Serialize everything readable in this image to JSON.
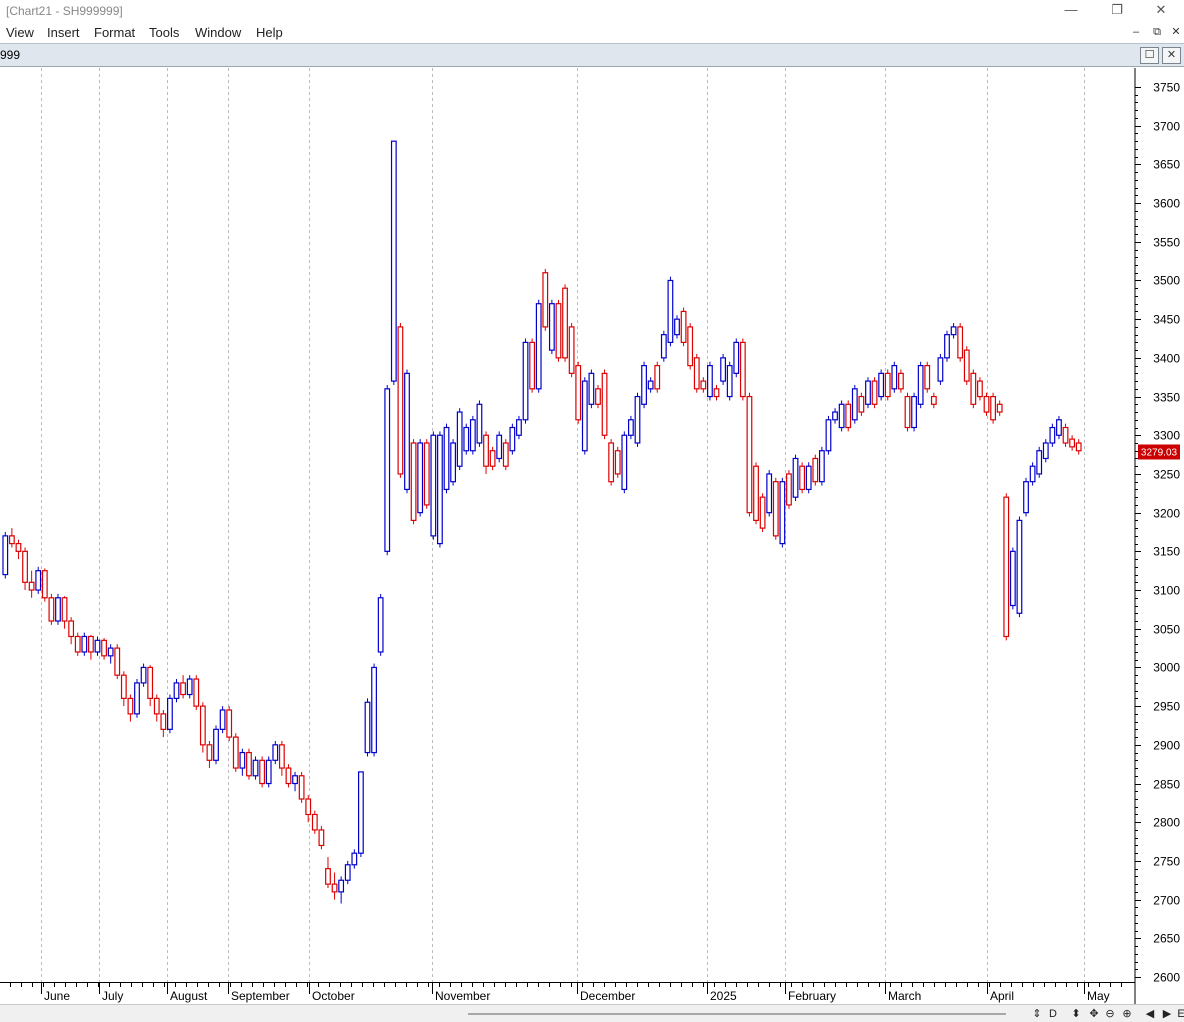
{
  "window": {
    "title": "[Chart21 - SH999999]",
    "controls": {
      "minimize": "—",
      "restore": "❐",
      "close": "✕"
    }
  },
  "menu": [
    "View",
    "Insert",
    "Format",
    "Tools",
    "Window",
    "Help"
  ],
  "child_window": {
    "title": "999",
    "controls": {
      "minimize": "–",
      "restore": "⧉",
      "close": "✕",
      "maximize": "☐",
      "close2": "✕"
    }
  },
  "bottom_nav": {
    "buttons": [
      "⇕",
      "D",
      "⬍",
      "✥",
      "⊖",
      "⊕",
      "◀",
      "▶",
      "E"
    ]
  },
  "colors": {
    "up": "#0000cc",
    "down": "#dd0000",
    "grid": "#bbbbbb",
    "badge_bg": "#cc0000"
  },
  "chart_data": {
    "type": "candlestick",
    "y_axis": {
      "ticks": [
        2600,
        2650,
        2700,
        2750,
        2800,
        2850,
        2900,
        2950,
        3000,
        3050,
        3100,
        3150,
        3200,
        3250,
        3300,
        3350,
        3400,
        3450,
        3500,
        3550,
        3600,
        3650,
        3700,
        3750
      ],
      "min": 2590,
      "max": 3770,
      "scale": "linear"
    },
    "x_axis": {
      "months": [
        "June",
        "July",
        "August",
        "September",
        "October",
        "November",
        "December",
        "2025",
        "February",
        "March",
        "April",
        "May"
      ]
    },
    "last_price": "3279.03",
    "grid": "vertical dashed at month boundaries",
    "candles": [
      [
        3120,
        3170,
        3115,
        3175
      ],
      [
        3170,
        3160,
        3155,
        3180
      ],
      [
        3160,
        3150,
        3140,
        3165
      ],
      [
        3150,
        3110,
        3100,
        3155
      ],
      [
        3110,
        3100,
        3090,
        3125
      ],
      [
        3100,
        3125,
        3095,
        3130
      ],
      [
        3125,
        3090,
        3085,
        3128
      ],
      [
        3090,
        3060,
        3055,
        3095
      ],
      [
        3060,
        3090,
        3055,
        3095
      ],
      [
        3090,
        3060,
        3050,
        3092
      ],
      [
        3060,
        3040,
        3030,
        3065
      ],
      [
        3040,
        3020,
        3015,
        3045
      ],
      [
        3020,
        3040,
        3015,
        3045
      ],
      [
        3040,
        3020,
        3010,
        3042
      ],
      [
        3020,
        3035,
        3015,
        3040
      ],
      [
        3035,
        3015,
        3010,
        3038
      ],
      [
        3015,
        3025,
        3005,
        3030
      ],
      [
        3025,
        2990,
        2985,
        3030
      ],
      [
        2990,
        2960,
        2950,
        2995
      ],
      [
        2960,
        2940,
        2930,
        2965
      ],
      [
        2940,
        2980,
        2935,
        2985
      ],
      [
        2980,
        3000,
        2975,
        3005
      ],
      [
        3000,
        2960,
        2950,
        3003
      ],
      [
        2960,
        2940,
        2930,
        2965
      ],
      [
        2940,
        2920,
        2910,
        2945
      ],
      [
        2920,
        2960,
        2915,
        2965
      ],
      [
        2960,
        2980,
        2955,
        2985
      ],
      [
        2980,
        2965,
        2960,
        2990
      ],
      [
        2965,
        2985,
        2960,
        2990
      ],
      [
        2985,
        2950,
        2945,
        2990
      ],
      [
        2950,
        2900,
        2890,
        2955
      ],
      [
        2900,
        2880,
        2870,
        2905
      ],
      [
        2880,
        2920,
        2875,
        2925
      ],
      [
        2920,
        2945,
        2915,
        2950
      ],
      [
        2945,
        2910,
        2905,
        2950
      ],
      [
        2910,
        2870,
        2865,
        2915
      ],
      [
        2870,
        2890,
        2860,
        2895
      ],
      [
        2890,
        2860,
        2855,
        2895
      ],
      [
        2860,
        2880,
        2855,
        2885
      ],
      [
        2880,
        2850,
        2845,
        2885
      ],
      [
        2850,
        2880,
        2845,
        2885
      ],
      [
        2880,
        2900,
        2875,
        2905
      ],
      [
        2900,
        2870,
        2860,
        2905
      ],
      [
        2870,
        2850,
        2845,
        2875
      ],
      [
        2850,
        2860,
        2840,
        2865
      ],
      [
        2860,
        2830,
        2825,
        2865
      ],
      [
        2830,
        2810,
        2800,
        2835
      ],
      [
        2810,
        2790,
        2785,
        2815
      ],
      [
        2790,
        2770,
        2765,
        2795
      ],
      [
        2740,
        2720,
        2715,
        2755
      ],
      [
        2720,
        2710,
        2700,
        2735
      ],
      [
        2710,
        2725,
        2695,
        2730
      ],
      [
        2725,
        2745,
        2720,
        2750
      ],
      [
        2745,
        2760,
        2740,
        2765
      ],
      [
        2760,
        2865,
        2755,
        2865
      ],
      [
        2890,
        2955,
        2885,
        2960
      ],
      [
        2890,
        3000,
        2885,
        3005
      ],
      [
        3020,
        3090,
        3015,
        3095
      ],
      [
        3150,
        3360,
        3145,
        3365
      ],
      [
        3370,
        3680,
        3365,
        3680
      ],
      [
        3440,
        3250,
        3245,
        3445
      ],
      [
        3230,
        3380,
        3225,
        3385
      ],
      [
        3290,
        3190,
        3185,
        3295
      ],
      [
        3200,
        3290,
        3195,
        3295
      ],
      [
        3290,
        3210,
        3205,
        3295
      ],
      [
        3170,
        3300,
        3165,
        3305
      ],
      [
        3160,
        3300,
        3155,
        3305
      ],
      [
        3230,
        3310,
        3225,
        3315
      ],
      [
        3240,
        3290,
        3235,
        3295
      ],
      [
        3260,
        3330,
        3255,
        3335
      ],
      [
        3280,
        3310,
        3275,
        3315
      ],
      [
        3280,
        3320,
        3275,
        3325
      ],
      [
        3290,
        3340,
        3285,
        3345
      ],
      [
        3300,
        3260,
        3250,
        3305
      ],
      [
        3280,
        3260,
        3255,
        3285
      ],
      [
        3270,
        3300,
        3265,
        3305
      ],
      [
        3290,
        3260,
        3255,
        3295
      ],
      [
        3280,
        3310,
        3275,
        3315
      ],
      [
        3300,
        3320,
        3295,
        3325
      ],
      [
        3320,
        3420,
        3315,
        3425
      ],
      [
        3420,
        3360,
        3355,
        3425
      ],
      [
        3360,
        3470,
        3355,
        3475
      ],
      [
        3510,
        3440,
        3435,
        3515
      ],
      [
        3410,
        3470,
        3405,
        3475
      ],
      [
        3470,
        3400,
        3395,
        3475
      ],
      [
        3490,
        3400,
        3395,
        3495
      ],
      [
        3440,
        3380,
        3375,
        3445
      ],
      [
        3390,
        3320,
        3315,
        3395
      ],
      [
        3280,
        3370,
        3275,
        3375
      ],
      [
        3340,
        3380,
        3335,
        3385
      ],
      [
        3360,
        3340,
        3335,
        3365
      ],
      [
        3380,
        3300,
        3295,
        3385
      ],
      [
        3290,
        3240,
        3235,
        3295
      ],
      [
        3280,
        3250,
        3245,
        3285
      ],
      [
        3230,
        3300,
        3225,
        3305
      ],
      [
        3300,
        3320,
        3295,
        3325
      ],
      [
        3290,
        3350,
        3285,
        3355
      ],
      [
        3340,
        3390,
        3335,
        3395
      ],
      [
        3360,
        3370,
        3355,
        3375
      ],
      [
        3390,
        3360,
        3355,
        3395
      ],
      [
        3400,
        3430,
        3395,
        3435
      ],
      [
        3420,
        3500,
        3415,
        3505
      ],
      [
        3430,
        3450,
        3425,
        3455
      ],
      [
        3460,
        3420,
        3415,
        3465
      ],
      [
        3440,
        3390,
        3385,
        3445
      ],
      [
        3400,
        3360,
        3355,
        3405
      ],
      [
        3370,
        3360,
        3355,
        3375
      ],
      [
        3350,
        3390,
        3345,
        3395
      ],
      [
        3360,
        3350,
        3345,
        3365
      ],
      [
        3370,
        3400,
        3365,
        3405
      ],
      [
        3350,
        3390,
        3345,
        3395
      ],
      [
        3380,
        3420,
        3375,
        3425
      ],
      [
        3420,
        3350,
        3345,
        3425
      ],
      [
        3350,
        3200,
        3195,
        3355
      ],
      [
        3260,
        3190,
        3185,
        3265
      ],
      [
        3220,
        3180,
        3175,
        3225
      ],
      [
        3200,
        3250,
        3195,
        3255
      ],
      [
        3240,
        3170,
        3165,
        3245
      ],
      [
        3160,
        3240,
        3155,
        3245
      ],
      [
        3250,
        3210,
        3205,
        3255
      ],
      [
        3220,
        3270,
        3215,
        3275
      ],
      [
        3260,
        3230,
        3225,
        3265
      ],
      [
        3230,
        3260,
        3225,
        3265
      ],
      [
        3270,
        3240,
        3235,
        3275
      ],
      [
        3240,
        3280,
        3235,
        3285
      ],
      [
        3280,
        3320,
        3275,
        3325
      ],
      [
        3320,
        3330,
        3315,
        3335
      ],
      [
        3310,
        3340,
        3305,
        3345
      ],
      [
        3340,
        3310,
        3305,
        3345
      ],
      [
        3320,
        3360,
        3315,
        3365
      ],
      [
        3350,
        3330,
        3325,
        3355
      ],
      [
        3340,
        3370,
        3335,
        3375
      ],
      [
        3370,
        3340,
        3335,
        3375
      ],
      [
        3350,
        3380,
        3345,
        3385
      ],
      [
        3380,
        3350,
        3345,
        3385
      ],
      [
        3360,
        3390,
        3355,
        3395
      ],
      [
        3380,
        3360,
        3355,
        3385
      ],
      [
        3350,
        3310,
        3305,
        3355
      ],
      [
        3310,
        3350,
        3305,
        3355
      ],
      [
        3340,
        3390,
        3335,
        3395
      ],
      [
        3390,
        3360,
        3355,
        3395
      ],
      [
        3350,
        3340,
        3335,
        3355
      ],
      [
        3370,
        3400,
        3365,
        3405
      ],
      [
        3400,
        3430,
        3395,
        3435
      ],
      [
        3430,
        3440,
        3425,
        3445
      ],
      [
        3440,
        3400,
        3395,
        3445
      ],
      [
        3410,
        3370,
        3365,
        3415
      ],
      [
        3380,
        3340,
        3335,
        3385
      ],
      [
        3370,
        3350,
        3345,
        3375
      ],
      [
        3350,
        3330,
        3325,
        3355
      ],
      [
        3350,
        3320,
        3315,
        3355
      ],
      [
        3340,
        3330,
        3325,
        3345
      ],
      [
        3220,
        3040,
        3035,
        3225
      ],
      [
        3080,
        3150,
        3075,
        3155
      ],
      [
        3070,
        3190,
        3065,
        3195
      ],
      [
        3200,
        3240,
        3195,
        3245
      ],
      [
        3240,
        3260,
        3235,
        3265
      ],
      [
        3250,
        3280,
        3245,
        3285
      ],
      [
        3270,
        3290,
        3265,
        3295
      ],
      [
        3290,
        3310,
        3285,
        3315
      ],
      [
        3300,
        3320,
        3295,
        3325
      ],
      [
        3310,
        3290,
        3285,
        3315
      ],
      [
        3295,
        3285,
        3280,
        3300
      ],
      [
        3290,
        3280,
        3275,
        3295
      ]
    ]
  }
}
